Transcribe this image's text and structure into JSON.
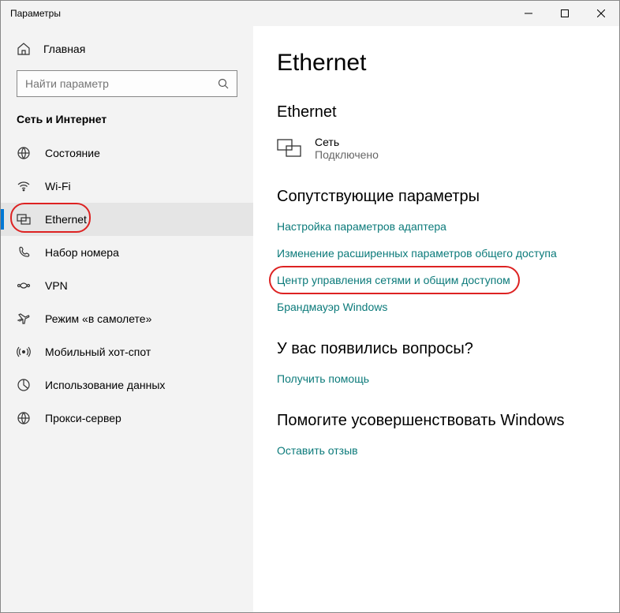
{
  "window": {
    "title": "Параметры"
  },
  "sidebar": {
    "home": "Главная",
    "search_placeholder": "Найти параметр",
    "category": "Сеть и Интернет",
    "items": [
      {
        "label": "Состояние"
      },
      {
        "label": "Wi-Fi"
      },
      {
        "label": "Ethernet"
      },
      {
        "label": "Набор номера"
      },
      {
        "label": "VPN"
      },
      {
        "label": "Режим «в самолете»"
      },
      {
        "label": "Мобильный хот-спот"
      },
      {
        "label": "Использование данных"
      },
      {
        "label": "Прокси-сервер"
      }
    ]
  },
  "main": {
    "title": "Ethernet",
    "section_ethernet": "Ethernet",
    "net": {
      "name": "Сеть",
      "status": "Подключено"
    },
    "related_title": "Сопутствующие параметры",
    "links": {
      "adapter": "Настройка параметров адаптера",
      "sharing": "Изменение расширенных параметров общего доступа",
      "center": "Центр управления сетями и общим доступом",
      "firewall": "Брандмауэр Windows"
    },
    "help_title": "У вас появились вопросы?",
    "help_link": "Получить помощь",
    "improve_title": "Помогите усовершенствовать Windows",
    "improve_link": "Оставить отзыв"
  }
}
